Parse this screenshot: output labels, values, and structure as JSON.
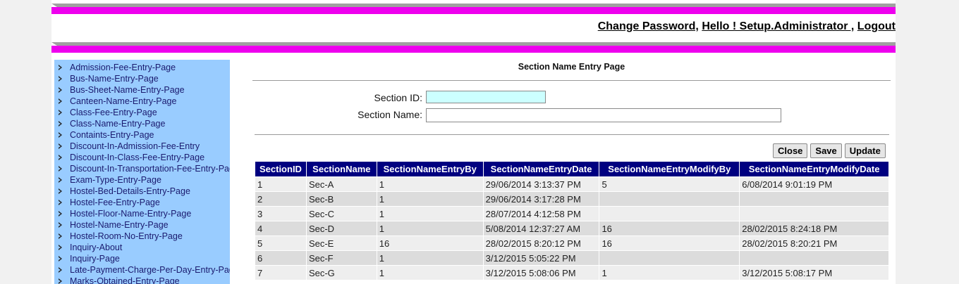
{
  "header": {
    "change_password": "Change Password,",
    "greeting": "Hello ! Setup.Administrator ,",
    "logout": "Logout"
  },
  "sidebar": {
    "items": [
      "Admission-Fee-Entry-Page",
      "Bus-Name-Entry-Page",
      "Bus-Sheet-Name-Entry-Page",
      "Canteen-Name-Entry-Page",
      "Class-Fee-Entry-Page",
      "Class-Name-Entry-Page",
      "Containts-Entry-Page",
      "Discount-In-Admission-Fee-Entry",
      "Discount-In-Class-Fee-Entry-Page",
      "Discount-In-Transportation-Fee-Entry-Page",
      "Exam-Type-Entry-Page",
      "Hostel-Bed-Details-Entry-Page",
      "Hostel-Fee-Entry-Page",
      "Hostel-Floor-Name-Entry-Page",
      "Hostel-Name-Entry-Page",
      "Hostel-Room-No-Entry-Page",
      "Inquiry-About",
      "Inquiry-Page",
      "Late-Payment-Charge-Per-Day-Entry-Page",
      "Marks-Obtained-Entry-Page"
    ]
  },
  "main": {
    "title": "Section Name Entry Page",
    "section_id_label": "Section ID:",
    "section_id_value": "",
    "section_name_label": "Section Name:",
    "section_name_value": "",
    "buttons": {
      "close": "Close",
      "save": "Save",
      "update": "Update"
    }
  },
  "table": {
    "columns": [
      "SectionID",
      "SectionName",
      "SectionNameEntryBy",
      "SectionNameEntryDate",
      "SectionNameEntryModifyBy",
      "SectionNameEntryModifyDate"
    ],
    "rows": [
      [
        "1",
        "Sec-A",
        "1",
        "29/06/2014 3:13:37 PM",
        "5",
        "6/08/2014 9:01:19 PM"
      ],
      [
        "2",
        "Sec-B",
        "1",
        "29/06/2014 3:17:28 PM",
        "",
        ""
      ],
      [
        "3",
        "Sec-C",
        "1",
        "28/07/2014 4:12:58 PM",
        "",
        ""
      ],
      [
        "4",
        "Sec-D",
        "1",
        "5/08/2014 12:37:27 AM",
        "16",
        "28/02/2015 8:24:18 PM"
      ],
      [
        "5",
        "Sec-E",
        "16",
        "28/02/2015 8:20:12 PM",
        "16",
        "28/02/2015 8:20:21 PM"
      ],
      [
        "6",
        "Sec-F",
        "1",
        "3/12/2015 5:05:22 PM",
        "",
        ""
      ],
      [
        "7",
        "Sec-G",
        "1",
        "3/12/2015 5:08:06 PM",
        "1",
        "3/12/2015 5:08:17 PM"
      ]
    ]
  }
}
